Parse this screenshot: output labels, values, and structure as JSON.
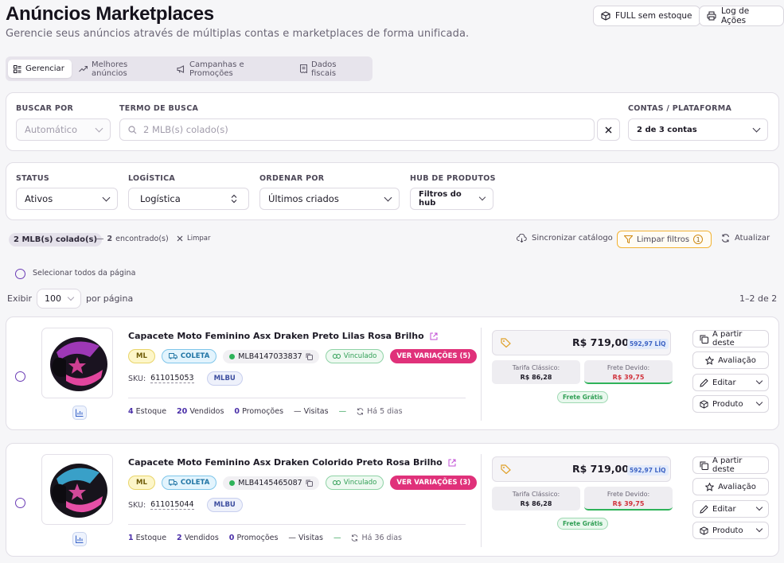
{
  "header": {
    "title": "Anúncios Marketplaces",
    "subtitle": "Gerencie seus anúncios através de múltiplas contas e marketplaces de forma unificada.",
    "buttons": [
      {
        "label": "FULL sem estoque",
        "icon": "box-icon"
      },
      {
        "label": "Log de Ações",
        "icon": "printer-icon"
      }
    ]
  },
  "tabs": [
    {
      "label": "Gerenciar",
      "icon": "list-icon",
      "active": true
    },
    {
      "label": "Melhores anúncios",
      "icon": "trend-icon",
      "active": false
    },
    {
      "label": "Campanhas e Promoções",
      "icon": "megaphone-icon",
      "active": false
    },
    {
      "label": "Dados fiscais",
      "icon": "receipt-icon",
      "active": false
    }
  ],
  "search": {
    "buscar_por_label": "BUSCAR POR",
    "buscar_por_value": "Automático",
    "termo_label": "TERMO DE BUSCA",
    "termo_placeholder": "2 MLB(s) colado(s)",
    "contas_label": "CONTAS / PLATAFORMA",
    "contas_value": "2 de 3 contas"
  },
  "filters": {
    "status_label": "STATUS",
    "status_value": "Ativos",
    "logistica_label": "LOGÍSTICA",
    "logistica_value": "Logística",
    "ordenar_label": "ORDENAR POR",
    "ordenar_value": "Últimos criados",
    "hub_label": "HUB DE PRODUTOS",
    "hub_value": "Filtros do hub"
  },
  "summary": {
    "pasted_pill": "2 MLB(s) colado(s)",
    "found_prefix": "—",
    "found_count": "2",
    "found_suffix": "encontrado(s)",
    "clear_label": "Limpar",
    "sync_label": "Sincronizar catálogo",
    "clear_filters_label": "Limpar filtros",
    "clear_filters_count": "1",
    "refresh_label": "Atualizar"
  },
  "select_all_label": "Selecionar todos da página",
  "pagination": {
    "show_label": "Exibir",
    "per_page_value": "100",
    "per_page_suffix": "por página",
    "range": "1–2 de 2"
  },
  "listings": [
    {
      "name": "Capacete Moto Feminino Asx Draken Preto Lilas Rosa Brilho",
      "badge_ml": "ML",
      "badge_coleta": "COLETA",
      "mlb": "MLB4147033837",
      "vinculado": "Vinculado",
      "variacoes": "VER VARIAÇÕES (5)",
      "sku_label": "SKU:",
      "sku": "611015053",
      "sku_badge": "MLBU",
      "estoque_num": "4",
      "estoque_label": "Estoque",
      "vendidos_num": "20",
      "vendidos_label": "Vendidos",
      "promocoes_num": "0",
      "promocoes_label": "Promoções",
      "visitas_prefix": "—",
      "visitas_label": "Visitas",
      "dash": "—",
      "age": "Há 5 dias",
      "price": "R$ 719,00",
      "liq": "592,97 LÍQ",
      "tarifa_label": "Tarifa Clássico:",
      "tarifa_value": "R$ 86,28",
      "frete_label": "Frete Devido:",
      "frete_value": "R$ 39,75",
      "frete_gratis": "Frete Grátis",
      "actions": [
        "A partir deste",
        "Avaliação",
        "Editar",
        "Produto"
      ],
      "helmet_colors": [
        "#1a1320",
        "#b63fd1",
        "#e2459e"
      ]
    },
    {
      "name": "Capacete Moto Feminino Asx Draken Colorido Preto Rosa Brilho",
      "badge_ml": "ML",
      "badge_coleta": "COLETA",
      "mlb": "MLB4145465087",
      "vinculado": "Vinculado",
      "variacoes": "VER VARIAÇÕES (3)",
      "sku_label": "SKU:",
      "sku": "611015044",
      "sku_badge": "MLBU",
      "estoque_num": "1",
      "estoque_label": "Estoque",
      "vendidos_num": "2",
      "vendidos_label": "Vendidos",
      "promocoes_num": "0",
      "promocoes_label": "Promoções",
      "visitas_prefix": "—",
      "visitas_label": "Visitas",
      "dash": "—",
      "age": "Há 36 dias",
      "price": "R$ 719,00",
      "liq": "592,97 LÍQ",
      "tarifa_label": "Tarifa Clássico:",
      "tarifa_value": "R$ 86,28",
      "frete_label": "Frete Devido:",
      "frete_value": "R$ 39,75",
      "frete_gratis": "Frete Grátis",
      "actions": [
        "A partir deste",
        "Avaliação",
        "Editar",
        "Produto"
      ],
      "helmet_colors": [
        "#17141c",
        "#3fb8e6",
        "#e64fa6"
      ]
    }
  ],
  "colors": {
    "accent_purple": "#6a3bb5",
    "pink_variations": "#e0317a",
    "orange_filter": "#f2b233",
    "green_vinculado": "#2f9e54",
    "red_frete": "#d0313b"
  }
}
